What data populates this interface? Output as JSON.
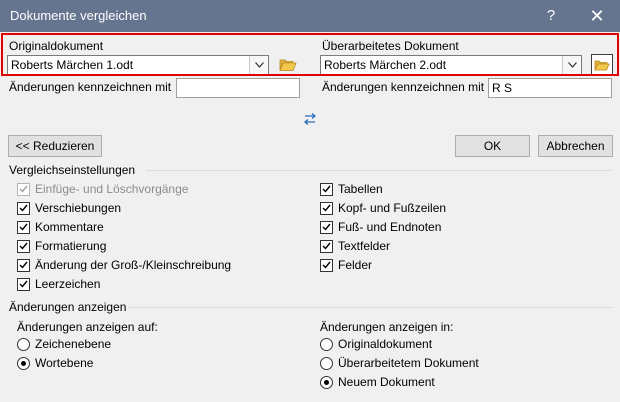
{
  "window": {
    "title": "Dokumente vergleichen",
    "help_label": "?",
    "close_label": "✕"
  },
  "original": {
    "label": "Originaldokument",
    "value": "Roberts Märchen 1.odt",
    "mark_label": "Änderungen kennzeichnen mit",
    "mark_value": ""
  },
  "revised": {
    "label": "Überarbeitetes Dokument",
    "value": "Roberts Märchen 2.odt",
    "mark_label": "Änderungen kennzeichnen mit",
    "mark_value": "R S"
  },
  "buttons": {
    "reduce": "<< Reduzieren",
    "ok": "OK",
    "cancel": "Abbrechen"
  },
  "compare_settings": {
    "heading": "Vergleichseinstellungen",
    "left": [
      {
        "label": "Einfüge- und Löschvorgänge",
        "checked": true,
        "disabled": true
      },
      {
        "label": "Verschiebungen",
        "checked": true,
        "disabled": false
      },
      {
        "label": "Kommentare",
        "checked": true,
        "disabled": false
      },
      {
        "label": "Formatierung",
        "checked": true,
        "disabled": false
      },
      {
        "label": "Änderung der Groß-/Kleinschreibung",
        "checked": true,
        "disabled": false
      },
      {
        "label": "Leerzeichen",
        "checked": true,
        "disabled": false
      }
    ],
    "right": [
      {
        "label": "Tabellen",
        "checked": true
      },
      {
        "label": "Kopf- und Fußzeilen",
        "checked": true
      },
      {
        "label": "Fuß- und Endnoten",
        "checked": true
      },
      {
        "label": "Textfelder",
        "checked": true
      },
      {
        "label": "Felder",
        "checked": true
      }
    ]
  },
  "show_changes": {
    "heading": "Änderungen anzeigen",
    "at_label": "Änderungen anzeigen auf:",
    "at_options": [
      {
        "label": "Zeichenebene",
        "selected": false
      },
      {
        "label": "Wortebene",
        "selected": true
      }
    ],
    "in_label": "Änderungen anzeigen in:",
    "in_options": [
      {
        "label": "Originaldokument",
        "selected": false
      },
      {
        "label": "Überarbeitetem Dokument",
        "selected": false
      },
      {
        "label": "Neuem Dokument",
        "selected": true
      }
    ]
  }
}
